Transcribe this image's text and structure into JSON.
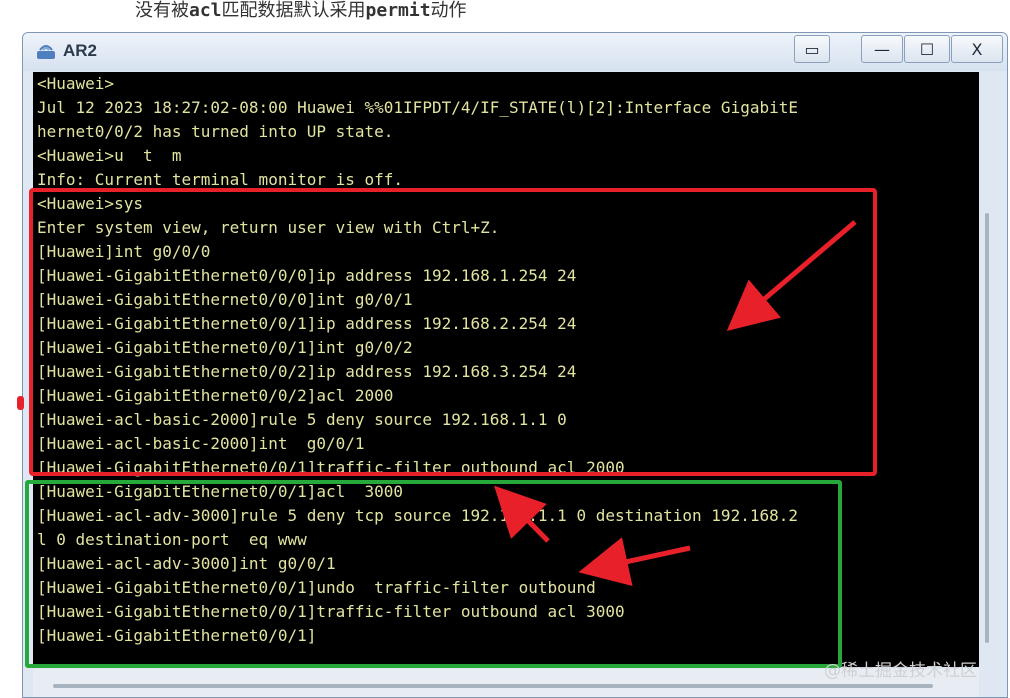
{
  "caption": {
    "part1": "没有被",
    "part2": "acl",
    "part3": "匹配数据默认采用",
    "part4": "permit",
    "part5": "动作"
  },
  "window": {
    "title": "AR2",
    "controls": {
      "restore": "▭",
      "minimize": "—",
      "maximize": "☐",
      "close": "X"
    }
  },
  "terminal": {
    "lines": [
      "<Huawei>",
      "Jul 12 2023 18:27:02-08:00 Huawei %%01IFPDT/4/IF_STATE(l)[2]:Interface GigabitE",
      "hernet0/0/2 has turned into UP state.",
      "<Huawei>u  t  m",
      "Info: Current terminal monitor is off.",
      "<Huawei>sys",
      "Enter system view, return user view with Ctrl+Z.",
      "[Huawei]int g0/0/0",
      "[Huawei-GigabitEthernet0/0/0]ip address 192.168.1.254 24",
      "[Huawei-GigabitEthernet0/0/0]int g0/0/1",
      "[Huawei-GigabitEthernet0/0/1]ip address 192.168.2.254 24",
      "[Huawei-GigabitEthernet0/0/1]int g0/0/2",
      "[Huawei-GigabitEthernet0/0/2]ip address 192.168.3.254 24",
      "[Huawei-GigabitEthernet0/0/2]acl 2000",
      "[Huawei-acl-basic-2000]rule 5 deny source 192.168.1.1 0",
      "[Huawei-acl-basic-2000]int  g0/0/1",
      "[Huawei-GigabitEthernet0/0/1]traffic-filter outbound acl 2000",
      "[Huawei-GigabitEthernet0/0/1]acl  3000",
      "[Huawei-acl-adv-3000]rule 5 deny tcp source 192.168.1.1 0 destination 192.168.2",
      "l 0 destination-port  eq www",
      "[Huawei-acl-adv-3000]int g0/0/1",
      "[Huawei-GigabitEthernet0/0/1]undo  traffic-filter outbound",
      "[Huawei-GigabitEthernet0/0/1]traffic-filter outbound acl 3000",
      "[Huawei-GigabitEthernet0/0/1]"
    ]
  },
  "watermark": "@稀土掘金技术社区",
  "colors": {
    "terminal_bg": "#000000",
    "terminal_text": "#e3e3a0",
    "red_annotation": "#e8202a",
    "green_annotation": "#27a83a"
  }
}
